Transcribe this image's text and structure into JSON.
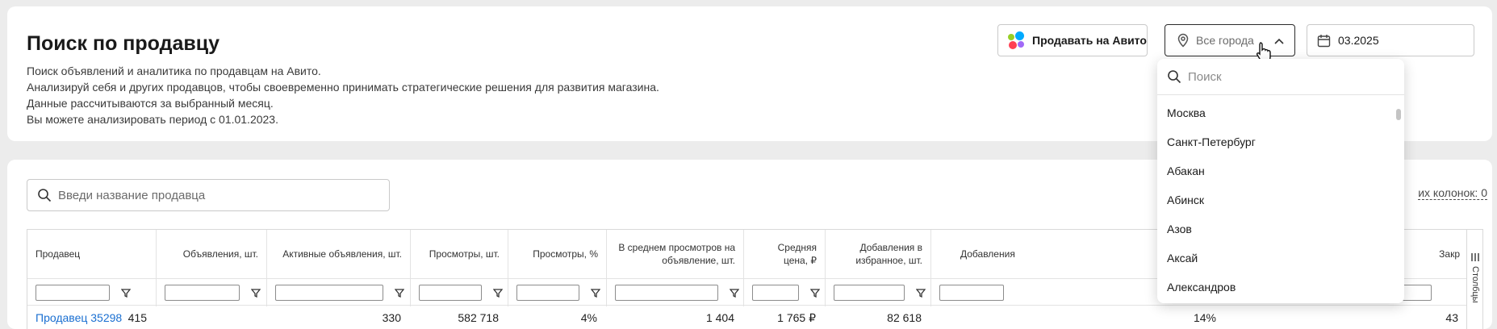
{
  "header": {
    "title": "Поиск по продавцу",
    "description": [
      "Поиск объявлений и аналитика по продавцам на Авито.",
      "Анализируй себя и других продавцов, чтобы своевременно принимать стратегические решения для развития магазина.",
      "Данные рассчитываются за выбранный месяц.",
      "Вы можете анализировать период с 01.01.2023."
    ],
    "sell_button": "Продавать на Авито",
    "city_select": "Все города",
    "date_value": "03.2025"
  },
  "dropdown": {
    "search_placeholder": "Поиск",
    "cities": [
      "Москва",
      "Санкт-Петербург",
      "Абакан",
      "Абинск",
      "Азов",
      "Аксай",
      "Александров"
    ]
  },
  "table_area": {
    "seller_search_placeholder": "Введи название продавца",
    "hidden_columns": "их колонок: 0",
    "columns_tab": "Столбцы",
    "columns": [
      "Продавец",
      "Объявления, шт.",
      "Активные объявления, шт.",
      "Просмотры, шт.",
      "Просмотры, %",
      "В среднем просмотров на объявление, шт.",
      "Средняя цена, ₽",
      "Добавления в избранное, шт.",
      "Добавления",
      "",
      "",
      "Закр"
    ],
    "first_row": [
      "Продавец 35298",
      "415",
      "330",
      "582 718",
      "4%",
      "1 404",
      "1 765 ₽",
      "82 618",
      "",
      "14%",
      "",
      "43"
    ]
  },
  "colors": {
    "link": "#1a6fd1",
    "accent_dots": [
      "#ff4053",
      "#00aaff",
      "#97cf26",
      "#a169f7"
    ]
  }
}
